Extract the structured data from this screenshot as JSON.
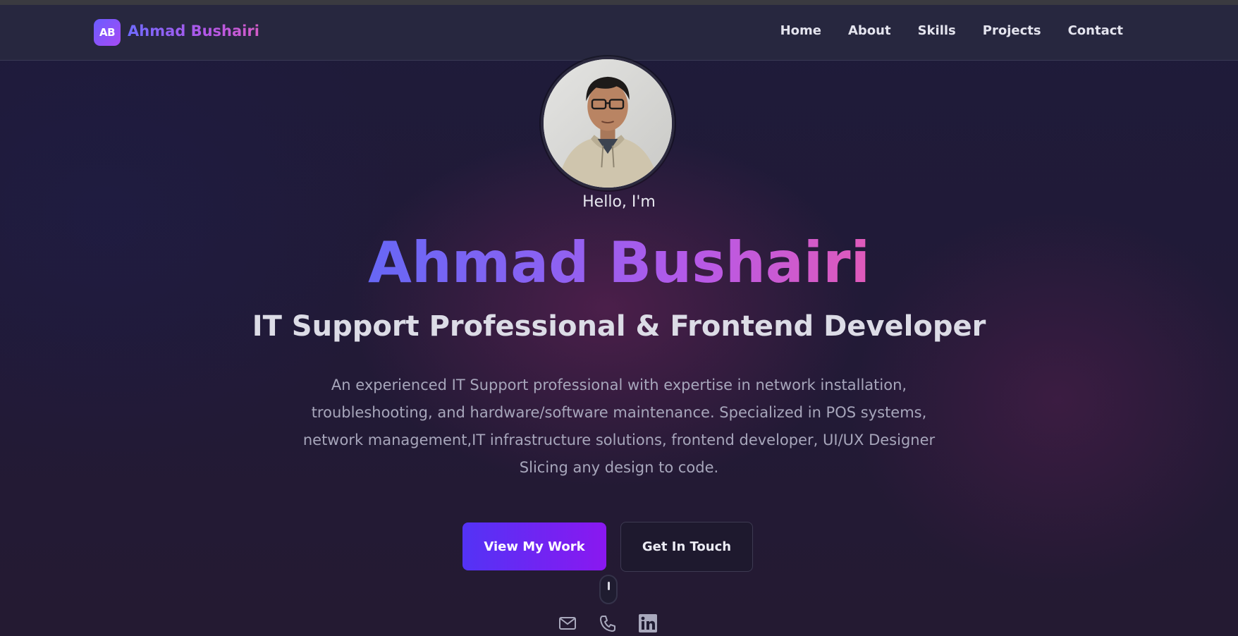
{
  "brand": {
    "badge": "AB",
    "name": "Ahmad Bushairi"
  },
  "nav": {
    "items": [
      {
        "label": "Home"
      },
      {
        "label": "About"
      },
      {
        "label": "Skills"
      },
      {
        "label": "Projects"
      },
      {
        "label": "Contact"
      }
    ]
  },
  "hero": {
    "greeting": "Hello, I'm",
    "name": "Ahmad Bushairi",
    "title": "IT Support Professional & Frontend Developer",
    "description": "An experienced IT Support professional with expertise in network installation, troubleshooting, and hardware/software maintenance. Specialized in POS systems, network management,IT infrastructure solutions, frontend developer, UI/UX Designer Slicing any design to code.",
    "primary_button": "View My Work",
    "secondary_button": "Get In Touch"
  },
  "socials": [
    {
      "icon": "mail-icon"
    },
    {
      "icon": "phone-icon"
    },
    {
      "icon": "linkedin-icon"
    }
  ],
  "colors": {
    "accent_start": "#5333f5",
    "accent_end": "#8a18f0",
    "gradient_pink": "#e05aba",
    "background": "#1d1a33",
    "nav_background": "#27273f"
  }
}
